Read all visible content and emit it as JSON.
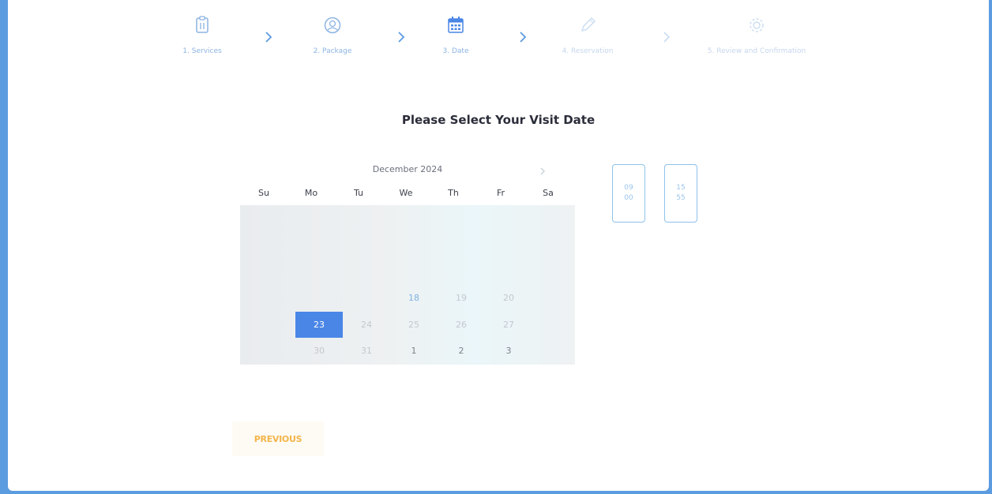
{
  "stepper": {
    "steps": [
      {
        "label": "1. Services",
        "icon": "clipboard-icon"
      },
      {
        "label": "2. Package",
        "icon": "user-circle-icon"
      },
      {
        "label": "3. Date",
        "icon": "calendar-icon"
      },
      {
        "label": "4. Reservation",
        "icon": "pen-icon"
      },
      {
        "label": "5. Review and Confirmation",
        "icon": "gear-icon"
      }
    ],
    "current": 3
  },
  "page": {
    "title": "Please Select Your Visit Date"
  },
  "calendar": {
    "month_label": "December 2024",
    "weekdays": [
      "Su",
      "Mo",
      "Tu",
      "We",
      "Th",
      "Fr",
      "Sa"
    ],
    "visible_days": [
      "18",
      "19",
      "20",
      "23",
      "24",
      "25",
      "26",
      "27",
      "30",
      "31",
      "1",
      "2",
      "3"
    ],
    "selected_day": "23"
  },
  "time_slots": [
    {
      "hour": "09",
      "minute": "00"
    },
    {
      "hour": "15",
      "minute": "55"
    }
  ],
  "navigation": {
    "previous_label": "PREVIOUS"
  },
  "colors": {
    "accent": "#4a86e6",
    "frame_border": "#5b9be0",
    "previous_text": "#f3b54a"
  }
}
